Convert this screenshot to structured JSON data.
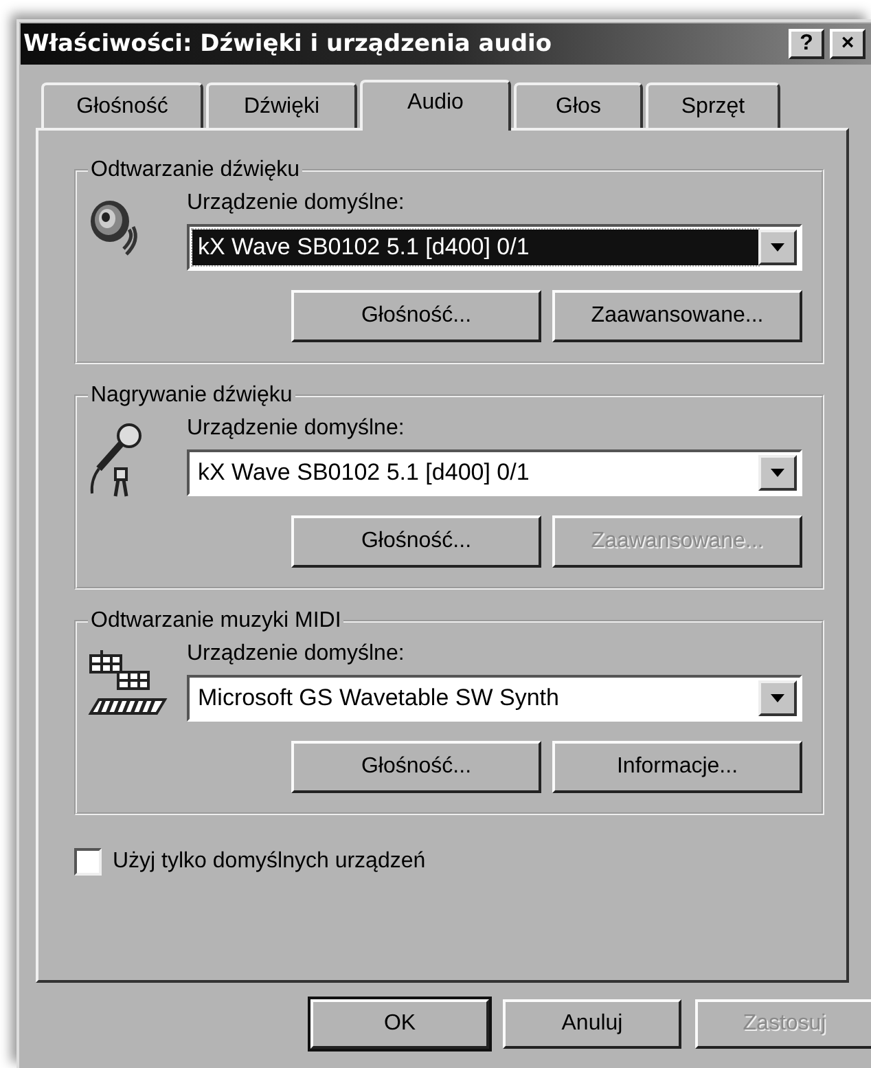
{
  "window": {
    "title": "Właściwości: Dźwięki i urządzenia audio",
    "help_button": "?",
    "close_button": "×"
  },
  "tabs": [
    {
      "label": "Głośność",
      "selected": false
    },
    {
      "label": "Dźwięki",
      "selected": false
    },
    {
      "label": "Audio",
      "selected": true
    },
    {
      "label": "Głos",
      "selected": false
    },
    {
      "label": "Sprzęt",
      "selected": false
    }
  ],
  "groups": [
    {
      "title": "Odtwarzanie dźwięku",
      "kind": "speaker",
      "label": "Urządzenie domyślne:",
      "device": "kX Wave SB0102 5.1 [d400] 0/1",
      "focused": true,
      "buttons": [
        {
          "label": "Głośność...",
          "disabled": false
        },
        {
          "label": "Zaawansowane...",
          "disabled": false
        }
      ]
    },
    {
      "title": "Nagrywanie dźwięku",
      "kind": "microphone",
      "label": "Urządzenie domyślne:",
      "device": "kX Wave SB0102 5.1 [d400] 0/1",
      "focused": false,
      "buttons": [
        {
          "label": "Głośność...",
          "disabled": false
        },
        {
          "label": "Zaawansowane...",
          "disabled": true
        }
      ]
    },
    {
      "title": "Odtwarzanie muzyki MIDI",
      "kind": "midi",
      "label": "Urządzenie domyślne:",
      "device": "Microsoft GS Wavetable SW Synth",
      "focused": false,
      "buttons": [
        {
          "label": "Głośność...",
          "disabled": false
        },
        {
          "label": "Informacje...",
          "disabled": false
        }
      ]
    }
  ],
  "checkbox": {
    "label": "Użyj tylko domyślnych urządzeń",
    "checked": false
  },
  "buttons": [
    {
      "label": "OK",
      "default": true,
      "disabled": false
    },
    {
      "label": "Anuluj",
      "default": false,
      "disabled": false
    },
    {
      "label": "Zastosuj",
      "default": false,
      "disabled": true
    }
  ]
}
